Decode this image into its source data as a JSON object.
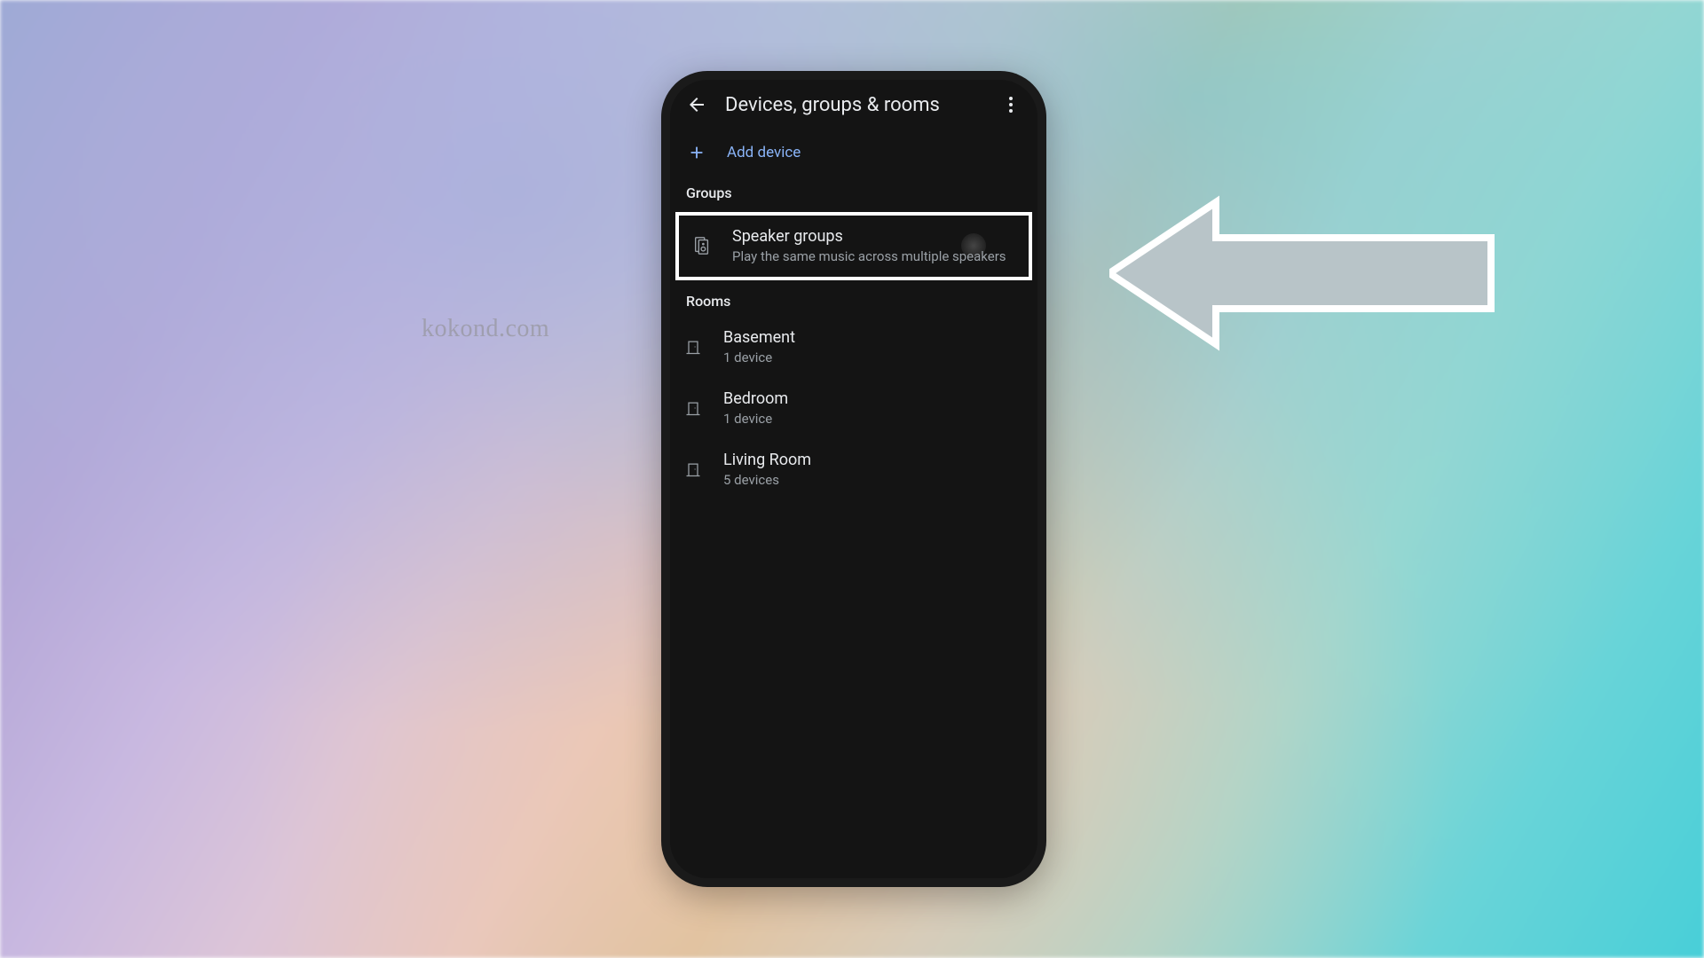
{
  "watermark": "kokond.com",
  "header": {
    "title": "Devices, groups & rooms"
  },
  "add_device": {
    "label": "Add device"
  },
  "sections": {
    "groups": {
      "header": "Groups",
      "speaker_groups": {
        "title": "Speaker groups",
        "subtitle": "Play the same music across multiple speakers"
      }
    },
    "rooms": {
      "header": "Rooms",
      "items": [
        {
          "title": "Basement",
          "subtitle": "1 device"
        },
        {
          "title": "Bedroom",
          "subtitle": "1 device"
        },
        {
          "title": "Living Room",
          "subtitle": "5 devices"
        }
      ]
    }
  }
}
